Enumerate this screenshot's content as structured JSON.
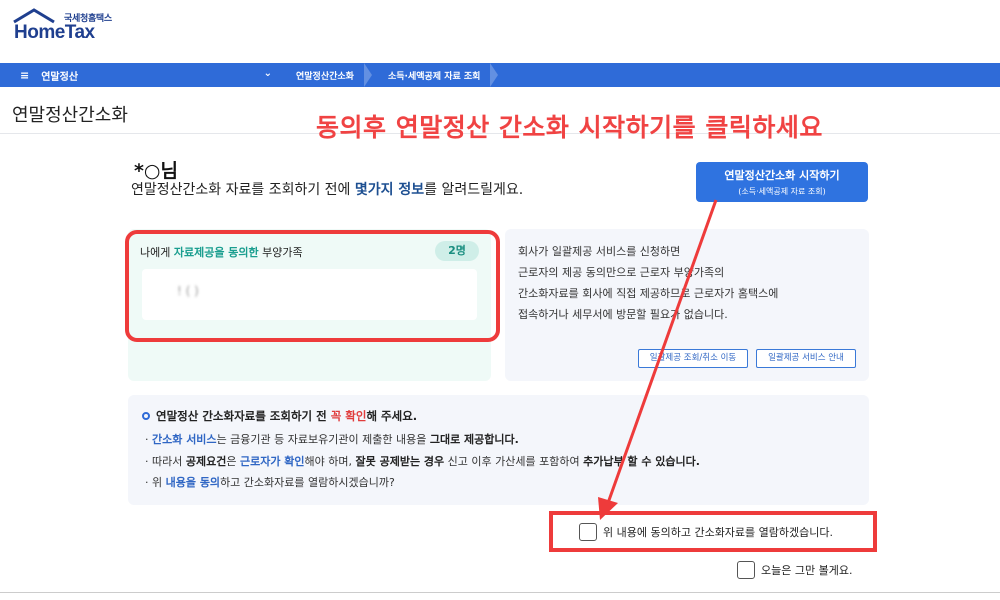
{
  "brand": {
    "sub": "국세청홈택스",
    "name": "HomeTax"
  },
  "nav": {
    "menu_label": "연말정산",
    "menu_icon": "hamburger-icon",
    "breadcrumbs": [
      "연말정산간소화",
      "소득·세액공제 자료 조회"
    ]
  },
  "page": {
    "title": "연말정산간소화"
  },
  "annotation": {
    "text": "동의후 연말정산 간소화 시작하기를 클릭하세요",
    "color": "#f04343"
  },
  "greeting": {
    "name": "*○님",
    "line_prefix": "연말정산간소화 자료를 조회하기 전에 ",
    "line_highlight": "몇가지 정보",
    "line_suffix": "를 알려드릴게요."
  },
  "start_button": {
    "label": "연말정산간소화 시작하기",
    "sublabel": "(소득·세액공제 자료 조회)"
  },
  "consent_panel": {
    "title_prefix": "나에게 ",
    "title_highlight": "자료제공을 동의한",
    "title_suffix": " 부양가족",
    "count": "2명",
    "dependents_masked": "!  (   )"
  },
  "info_panel": {
    "lines": [
      "회사가 일괄제공 서비스를 신청하면",
      "근로자의 제공 동의만으로 근로자 부양가족의",
      "간소화자료를 회사에 직접 제공하므로 근로자가 홈택스에",
      "접속하거나 세무서에 방문할 필요가 없습니다."
    ],
    "buttons": [
      "일괄제공 조회/취소 이동",
      "일괄제공 서비스 안내"
    ]
  },
  "notice": {
    "head_prefix": "연말정산 간소화자료를 조회하기 전 ",
    "head_highlight": "꼭 확인",
    "head_suffix": "해 주세요.",
    "line1_blue": "간소화 서비스",
    "line1_mid": "는 금융기관 등 자료보유기관이 제출한 내용을 ",
    "line1_bold": "그대로 제공합니다.",
    "line2_a": "따라서 ",
    "line2_b": "공제요건",
    "line2_c": "은 ",
    "line2_d": "근로자가 확인",
    "line2_e": "해야 하며, ",
    "line2_f": "잘못 공제받는 경우",
    "line2_g": " 신고 이후 가산세를 포함하여 ",
    "line2_h": "추가납부 할 수 있습니다.",
    "line3_a": "위 ",
    "line3_b": "내용을 동의",
    "line3_c": "하고 간소화자료를 열람하시겠습니까?"
  },
  "checkboxes": {
    "agree": "위 내용에 동의하고 간소화자료를 열람하겠습니다.",
    "today": "오늘은 그만 볼게요."
  }
}
